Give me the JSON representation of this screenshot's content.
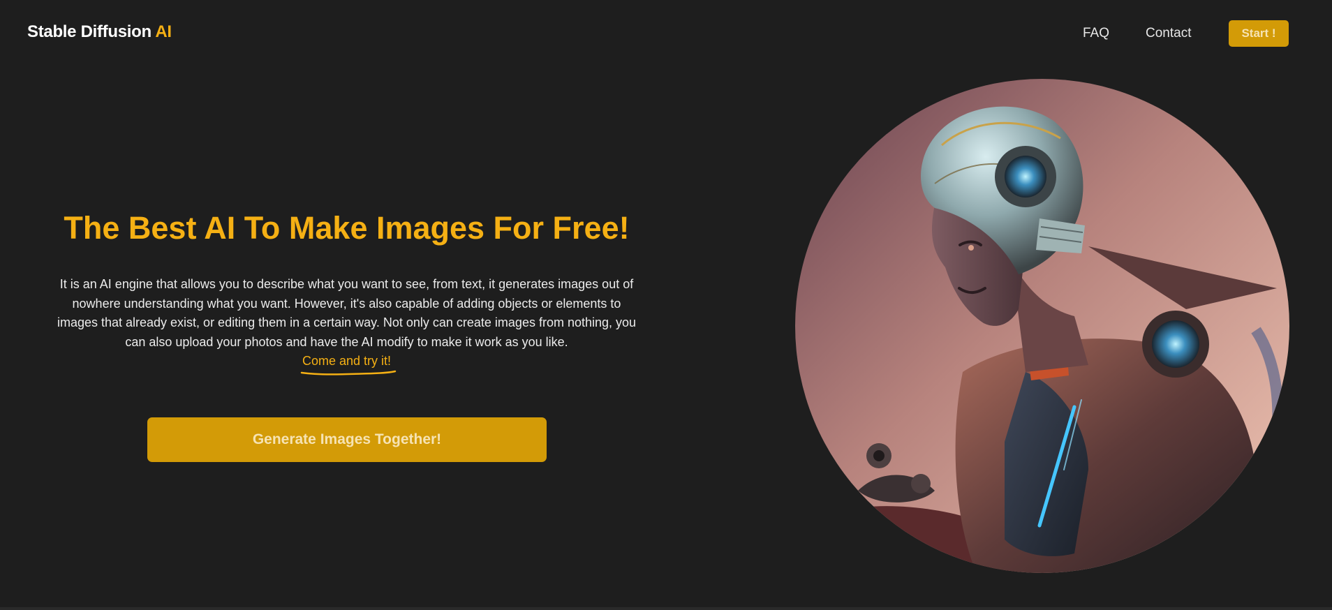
{
  "header": {
    "logo_main": "Stable Diffusion",
    "logo_accent": "AI",
    "nav": {
      "faq": "FAQ",
      "contact": "Contact",
      "start": "Start !"
    }
  },
  "hero": {
    "title": "The Best AI To Make Images For Free!",
    "description": "It is an AI engine that allows you to describe what you want to see, from text, it generates images out of nowhere understanding what you want. However, it's also capable of adding objects or elements to images that already exist, or editing them in a certain way. Not only can create images from nothing, you can also upload your photos and have the AI modify to make it work as you like.",
    "cta_link": "Come and try it!",
    "button": "Generate Images Together!"
  },
  "colors": {
    "background": "#1e1e1e",
    "accent": "#f5b014",
    "button": "#d39b07",
    "button_text": "#f6e3b3"
  },
  "image": {
    "subject": "robot-illustration"
  }
}
